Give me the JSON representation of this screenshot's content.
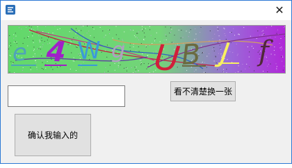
{
  "window": {
    "close_glyph": "✕",
    "app_icon": "app-logo-icon"
  },
  "captcha": {
    "characters": [
      "e",
      "4",
      "W",
      "g",
      "U",
      "B",
      "J",
      "f"
    ],
    "colors": [
      "#4fa3b8",
      "#a020c8",
      "#3a9ad8",
      "#b0a0c0",
      "#d0203a",
      "#6a6a40",
      "#f8f060",
      "#502838"
    ],
    "background_start": "#62d86a",
    "background_end": "#b028d8"
  },
  "input": {
    "value": "",
    "placeholder": ""
  },
  "buttons": {
    "refresh_label": "看不清楚换一张",
    "confirm_label": "确认我输入的"
  }
}
